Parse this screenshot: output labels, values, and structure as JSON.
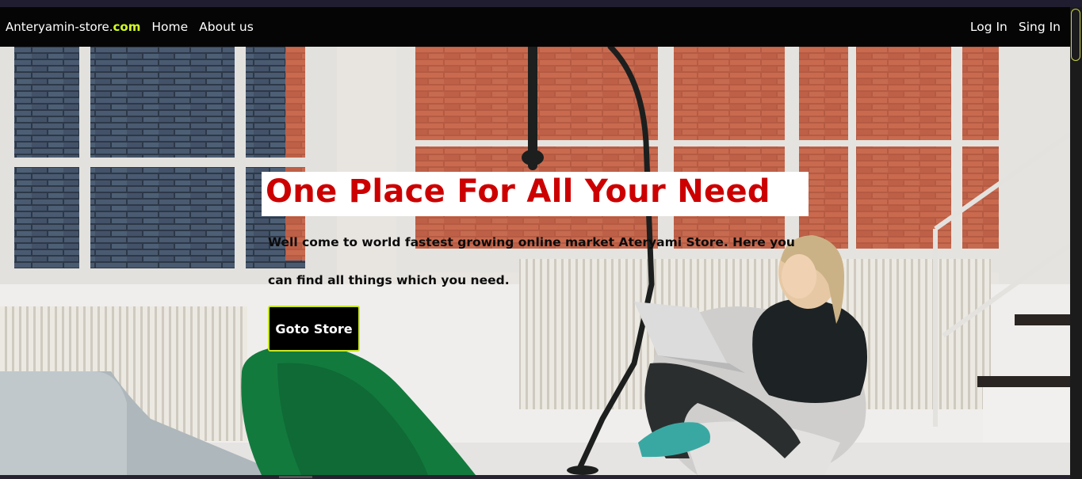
{
  "navbar": {
    "brand_main": "Anteryamin-store.",
    "brand_accent": "com",
    "links": [
      "Home",
      "About us"
    ],
    "auth": [
      "Log In",
      "Sing In"
    ]
  },
  "hero": {
    "headline": "One Place For All Your Need",
    "subtext": "Well come to world fastest growing online market Ateryami Store. Here you can find all things which you need.",
    "cta_label": "Goto Store",
    "background_image": "woman-with-laptop-in-armchair-photo"
  },
  "colors": {
    "accent": "#d4ff1e",
    "headline": "#cc0000",
    "navbar_bg": "#050505"
  }
}
